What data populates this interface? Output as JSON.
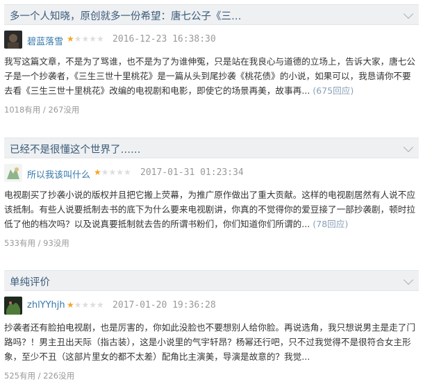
{
  "reviews": [
    {
      "title": "多一个人知晓，原创就多一份希望：唐七公子《三…",
      "user": "碧蓝落雪",
      "rating": 1,
      "rating_max": 5,
      "time": "2016-12-23 16:38:30",
      "body": "我写这篇文章，不是为了骂谁，也不是为了为谁伸冤，只是站在我良心与道德的立场上，告诉大家，唐七公子是一个抄袭者，《三生三世十里桃花》是一篇从头到尾抄袭《桃花债》的小说，如果可以，我恳请你不要去看《三生三世十里桃花》改编的电视剧和电影，即使它的场景再美，故事再",
      "more": "...",
      "reply": "(675回应)",
      "votes": "1018有用 / 267没用"
    },
    {
      "title": "已经不是很懂这个世界了……",
      "user": "所以我该叫什么",
      "rating": 1,
      "rating_max": 5,
      "time": "2017-01-31 01:23:34",
      "body": "电视剧买了抄袭小说的版权并且把它搬上荧幕，为推广原作做出了重大贡献。这样的电视剧居然有人说不应该抵制。有些人说要抵制去书的底下为什么要来电视剧讲，你真的不觉得你的爱豆接了一部抄袭剧，顿时拉低了他的档次吗？以及说真要抵制就去告的所谓书粉们，你们知道你们所谓的",
      "more": "...",
      "reply": "(78回应)",
      "votes": "533有用 / 93没用"
    },
    {
      "title": "单纯评价",
      "user": "zhlYYhjh",
      "rating": 1,
      "rating_max": 5,
      "time": "2017-01-20 19:36:28",
      "body": "抄袭者还有脸拍电视剧，也是厉害的，你如此没脸也不要想别人给你脸。再说选角，我只想说男主是走了门路吗？！男主丑出天际（指古装），这是小说里的气宇轩昂？杨幂还行吧，只不过我觉得不是很符合女主形象，至少不丑（这部片里女的都不太差）配角比主演美，导演是故意的？我觉",
      "more": "...",
      "reply": "",
      "votes": "525有用 / 226没用"
    }
  ],
  "colors": {
    "star": "#f5a623",
    "link": "#3377aa",
    "title_bg": "#eef0f2"
  }
}
